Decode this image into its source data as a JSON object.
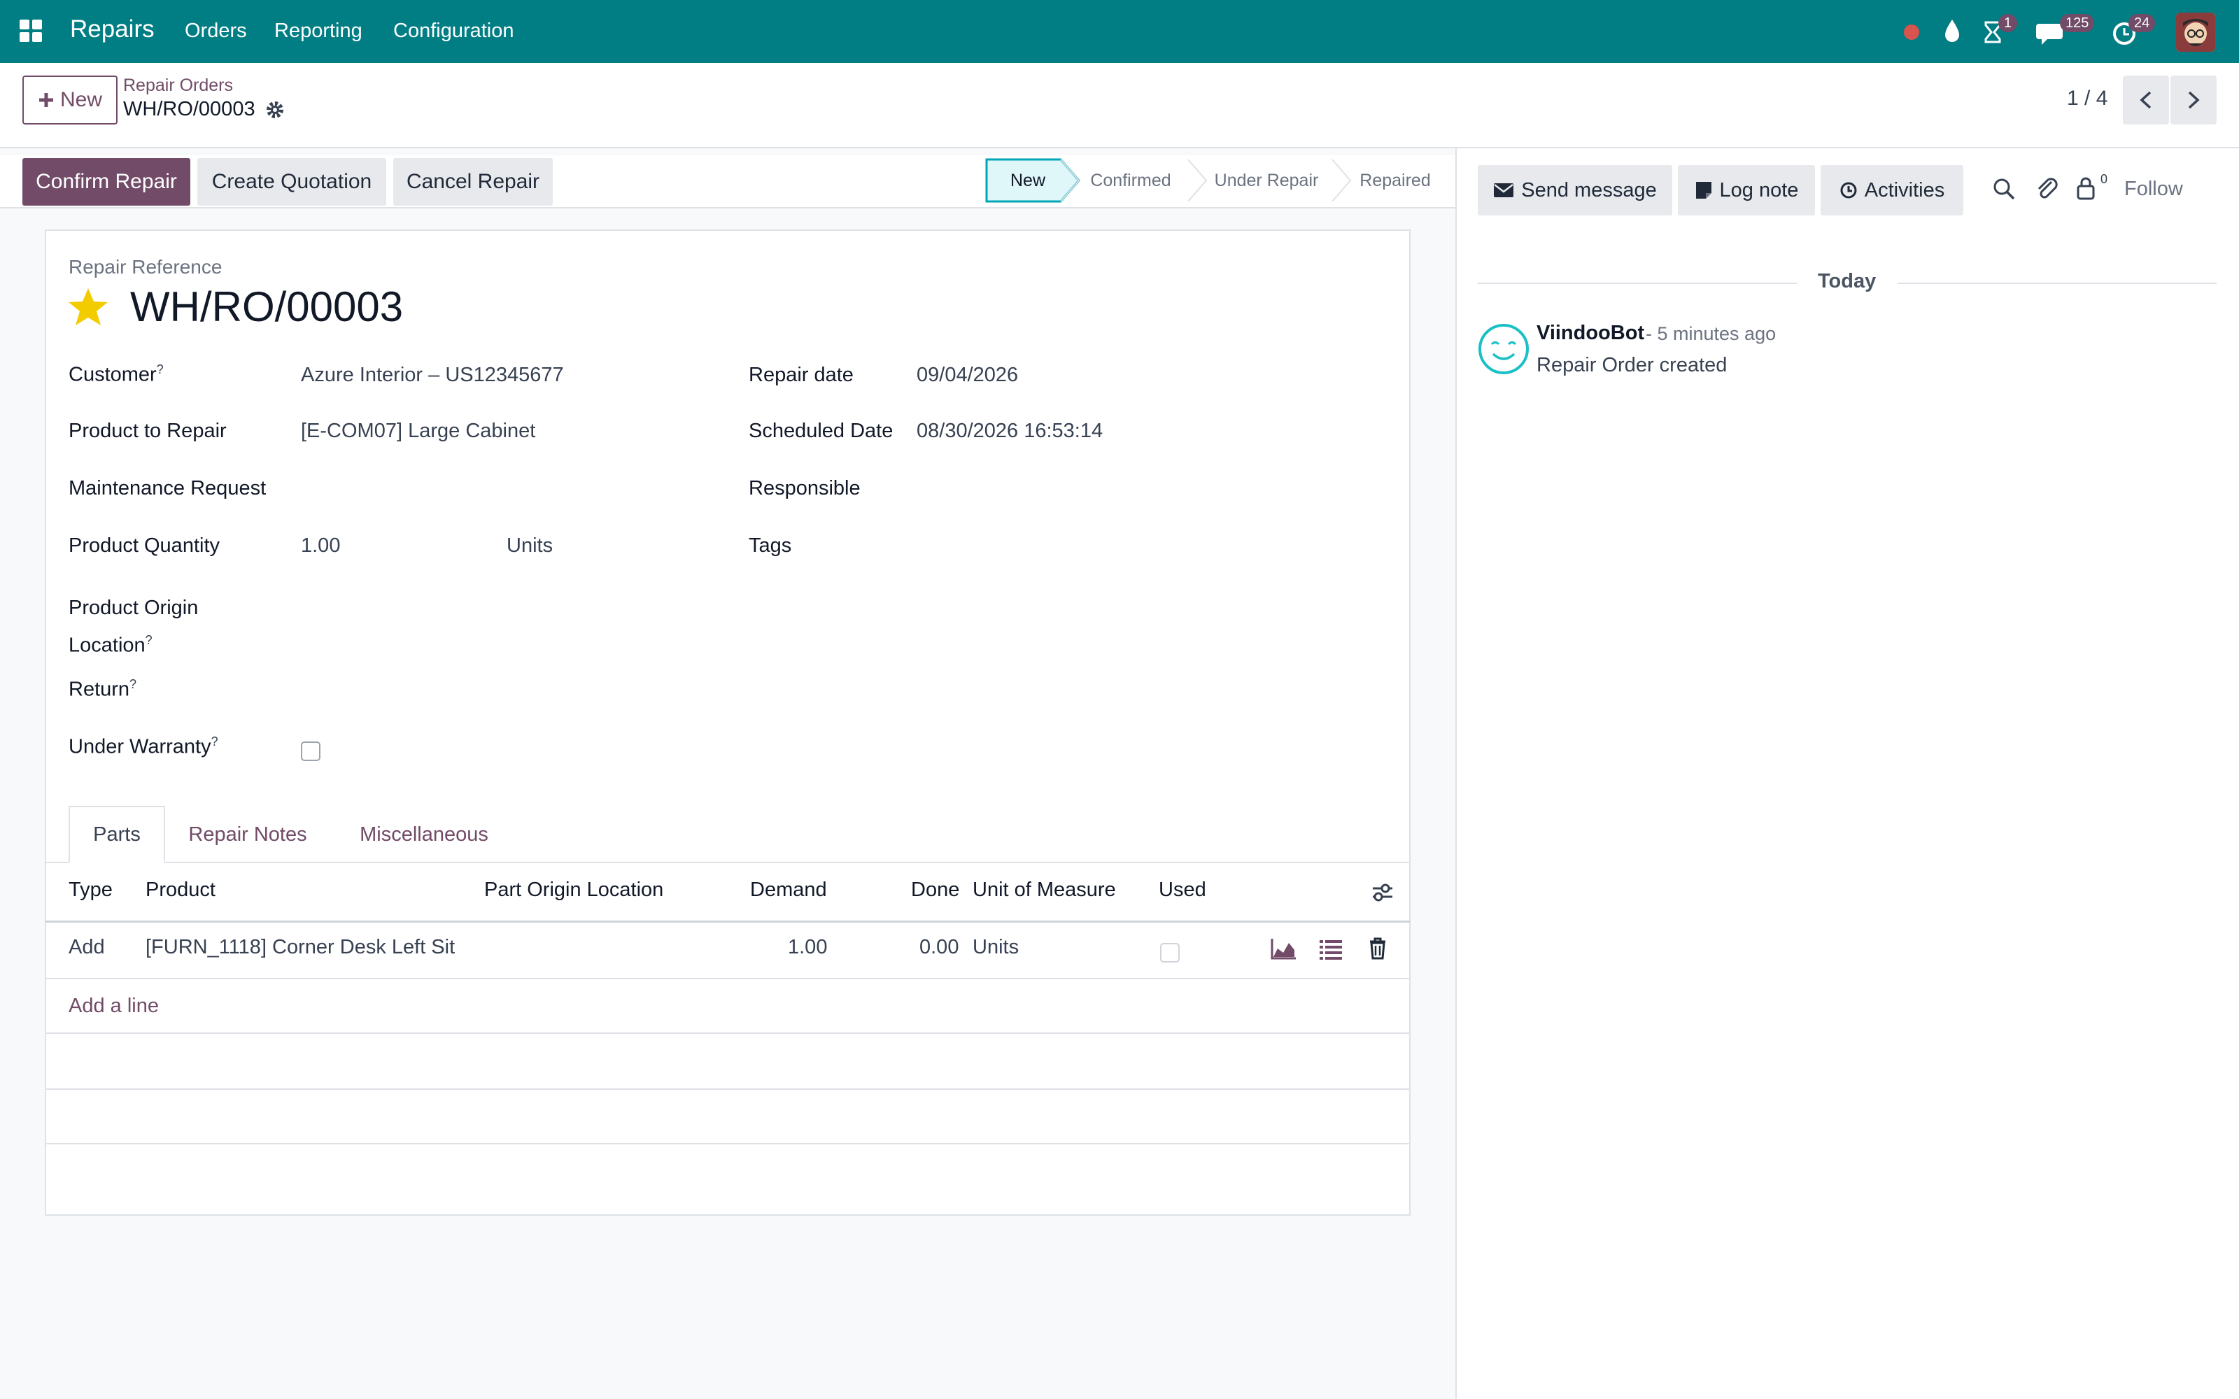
{
  "navbar": {
    "app_name": "Repairs",
    "menus": [
      "Orders",
      "Reporting",
      "Configuration"
    ],
    "badges": {
      "activities": "1",
      "messages": "125",
      "timesheet": "24"
    },
    "bg_color": "#017e84"
  },
  "control_panel": {
    "new_label": "New",
    "breadcrumb_parent": "Repair Orders",
    "breadcrumb_current": "WH/RO/00003",
    "pager": "1 / 4"
  },
  "actions": {
    "confirm": "Confirm Repair",
    "quotation": "Create Quotation",
    "cancel": "Cancel Repair"
  },
  "stages": [
    "New",
    "Confirmed",
    "Under Repair",
    "Repaired"
  ],
  "form": {
    "reference_label": "Repair Reference",
    "reference": "WH/RO/00003",
    "left_fields": [
      {
        "label": "Customer",
        "help": "?",
        "value": "Azure Interior – US12345677"
      },
      {
        "label": "Product to Repair",
        "help": "",
        "value": "[E-COM07] Large Cabinet"
      },
      {
        "label": "Maintenance Request",
        "help": "",
        "value": ""
      },
      {
        "label": "Product Quantity",
        "help": "",
        "value": "1.00",
        "unit": "Units"
      },
      {
        "label_line1": "Product Origin",
        "label_line2": "Location",
        "help": "?"
      },
      {
        "label": "Return",
        "help": "?"
      },
      {
        "label": "Under Warranty",
        "help": "?",
        "checked": false
      }
    ],
    "right_fields": [
      {
        "label": "Repair date",
        "value": "09/04/2026"
      },
      {
        "label": "Scheduled Date",
        "value": "08/30/2026 16:53:14"
      },
      {
        "label": "Responsible",
        "value": ""
      },
      {
        "label": "Tags",
        "value": ""
      }
    ]
  },
  "tabs": [
    "Parts",
    "Repair Notes",
    "Miscellaneous"
  ],
  "parts_table": {
    "columns": [
      "Type",
      "Product",
      "Part Origin Location",
      "Demand",
      "Done",
      "Unit of Measure",
      "Used"
    ],
    "rows": [
      {
        "type": "Add",
        "product": "[FURN_1118] Corner Desk Left Sit",
        "origin": "",
        "demand": "1.00",
        "done": "0.00",
        "uom": "Units",
        "used": false
      }
    ],
    "add_line": "Add a line"
  },
  "chatter": {
    "send_message": "Send message",
    "log_note": "Log note",
    "activities": "Activities",
    "followers_count": "0",
    "follow": "Follow",
    "date_separator": "Today",
    "messages": [
      {
        "author": "ViindooBot",
        "time": "- 5 minutes ago",
        "body": "Repair Order created"
      }
    ]
  }
}
